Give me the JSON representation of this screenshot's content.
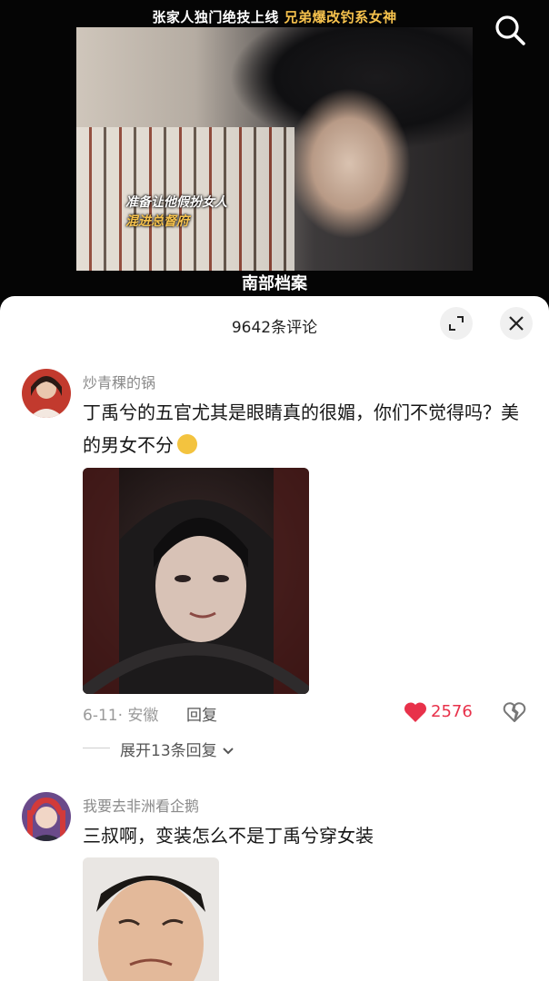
{
  "video": {
    "title_part1": "张家人独门绝技上线",
    "title_part2": "兄弟爆改钓系女神",
    "subtitle_line1": "准备让他假扮女人",
    "subtitle_line2": "混进总督府",
    "logo": "南部档案"
  },
  "comments_panel": {
    "count_label": "9642条评论"
  },
  "comments": [
    {
      "username": "炒青稞的锅",
      "text": "丁禹兮的五官尤其是眼睛真的很媚，你们不觉得吗？美的男女不分",
      "date_location": "6-11· 安徽",
      "reply_label": "回复",
      "likes": "2576",
      "expand_label": "展开13条回复"
    },
    {
      "username": "我要去非洲看企鹅",
      "text": "三叔啊，变装怎么不是丁禹兮穿女装"
    }
  ],
  "colors": {
    "accent": "#e8314a",
    "highlight": "#f6c24d"
  }
}
